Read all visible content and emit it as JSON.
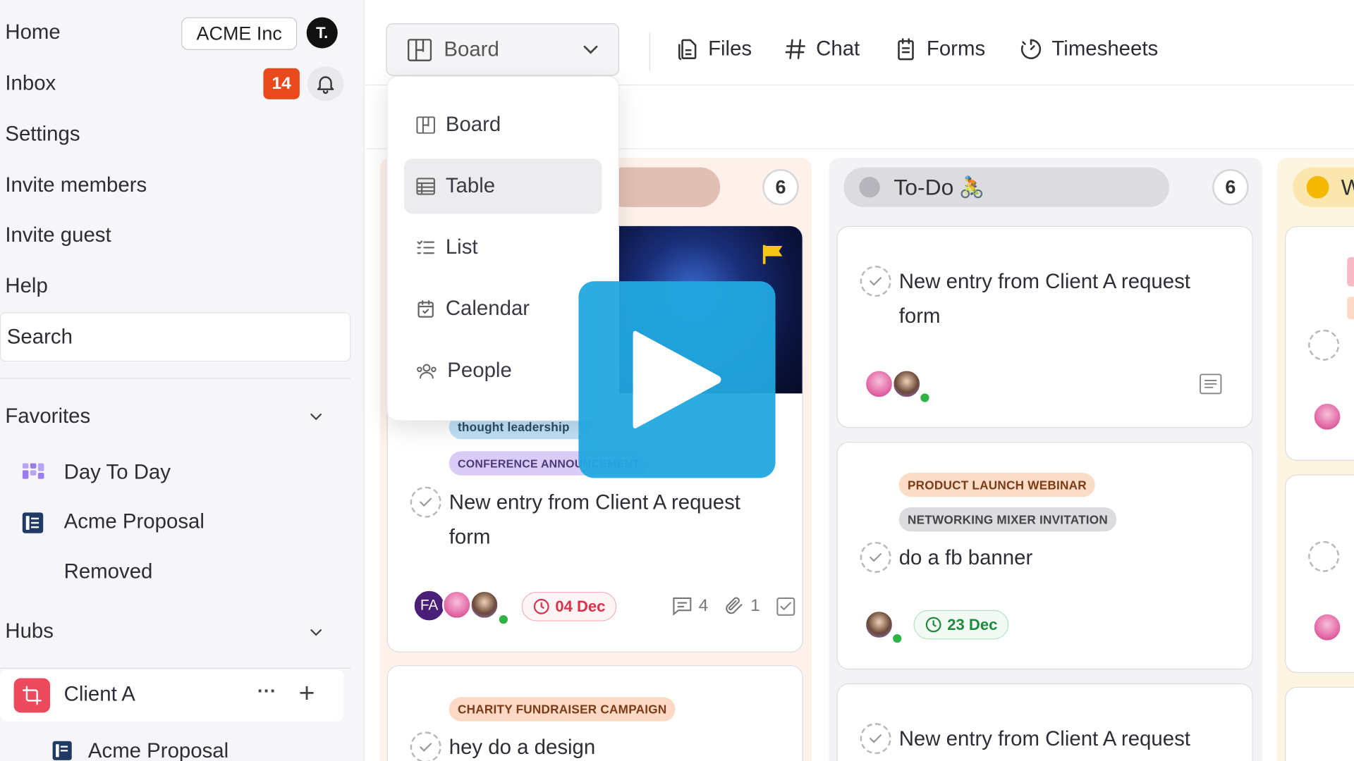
{
  "sidebar": {
    "home": "Home",
    "org_name": "ACME Inc",
    "avatar_initial": "T.",
    "inbox": "Inbox",
    "inbox_count": "14",
    "settings": "Settings",
    "invite_members": "Invite members",
    "invite_guest": "Invite guest",
    "help": "Help",
    "search": "Search",
    "favorites_title": "Favorites",
    "favorites": [
      "Day To Day",
      "Acme Proposal",
      "Removed"
    ],
    "hubs_title": "Hubs",
    "hub_name": "Client A",
    "hub_more": "···",
    "hub_add": "+",
    "hub_child": "Acme Proposal"
  },
  "toolbar": {
    "view_label": "Board",
    "tabs": [
      "Files",
      "Chat",
      "Forms",
      "Timesheets"
    ]
  },
  "view_menu": {
    "items": [
      "Board",
      "Table",
      "List",
      "Calendar",
      "People"
    ],
    "active": "Table"
  },
  "board": {
    "col1": {
      "count": "6",
      "card1": {
        "tags": [
          "thought leadership",
          "CONFERENCE ANNOUNCEMENT"
        ],
        "title": "New entry from Client A request form",
        "initials": "FA",
        "date": "04 Dec",
        "comments": "4",
        "attachments": "1"
      },
      "card2": {
        "tag": "CHARITY FUNDRAISER CAMPAIGN",
        "title": "hey do a design"
      }
    },
    "col2": {
      "title": "To-Do",
      "emoji": "🚴",
      "count": "6",
      "card1": {
        "title": "New entry from Client A request form"
      },
      "card2": {
        "tags": [
          "PRODUCT LAUNCH WEBINAR",
          "NETWORKING MIXER INVITATION"
        ],
        "title": "do a fb banner",
        "date": "23 Dec"
      },
      "card3": {
        "title": "New entry from Client A request"
      }
    },
    "col3": {
      "title_partial": "W"
    }
  },
  "colors": {
    "accent_blue": "#22a8df",
    "badge_red": "#e8491d",
    "col1_bg": "#fdf1ea",
    "col2_bg": "#f3f3f5",
    "col3_bg": "#fdf5e1"
  }
}
